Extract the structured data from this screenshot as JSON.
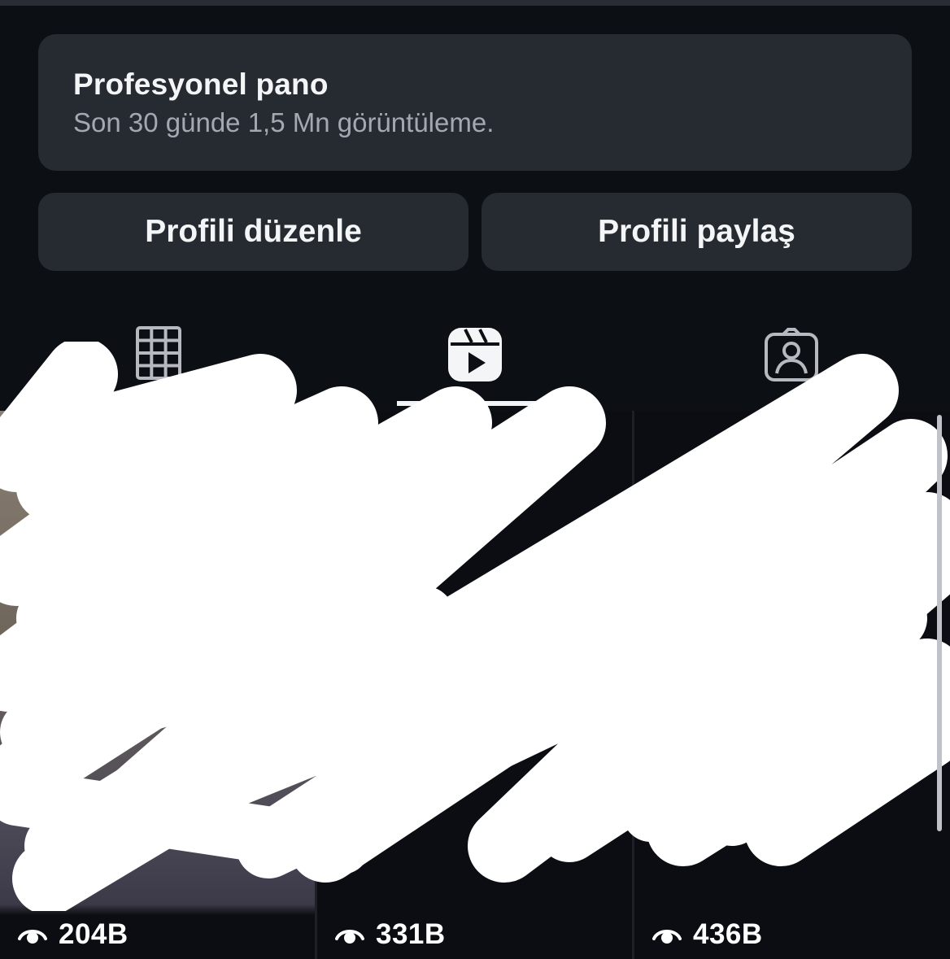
{
  "dashboard": {
    "title": "Profesyonel pano",
    "subtitle": "Son 30 günde 1,5 Mn görüntüleme."
  },
  "actions": {
    "edit_label": "Profili düzenle",
    "share_label": "Profili paylaş"
  },
  "tabs": [
    {
      "name": "grid",
      "icon": "grid-icon",
      "active": false
    },
    {
      "name": "reels",
      "icon": "reels-icon",
      "active": true
    },
    {
      "name": "tagged",
      "icon": "tagged-person-icon",
      "active": false
    }
  ],
  "reels": [
    {
      "views": "204B"
    },
    {
      "views": "331B"
    },
    {
      "views": "436B"
    }
  ],
  "colors": {
    "background": "#0c0f14",
    "card": "#262a31",
    "text": "#f4f5f7",
    "muted": "#a4a8b0"
  }
}
